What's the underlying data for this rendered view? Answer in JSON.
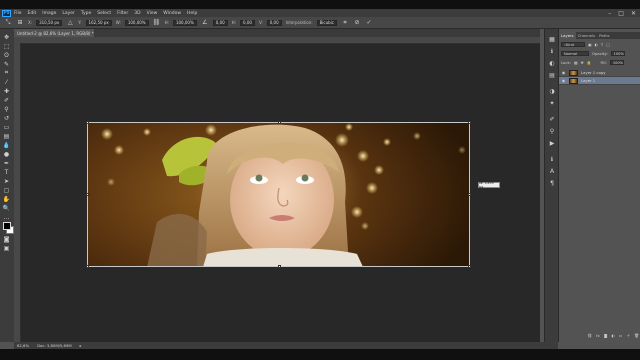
{
  "app": {
    "logo": "Ps"
  },
  "menu": [
    "File",
    "Edit",
    "Image",
    "Layer",
    "Type",
    "Select",
    "Filter",
    "3D",
    "View",
    "Window",
    "Help"
  ],
  "window_controls": [
    "–",
    "□",
    "✕"
  ],
  "options": {
    "x_value": "310,50 px",
    "y_value": "162,50 px",
    "w_value": "100,00%",
    "h_value": "100,00%",
    "angle_value": "0,00",
    "h_skew_value": "0,00",
    "v_skew_value": "0,00",
    "interpolation_label": "Interpolation:",
    "interpolation_value": "Bicubic"
  },
  "document": {
    "tab_title": "Untitled-2 @ 82,6% (Layer 1, RGB/8) *"
  },
  "canvas": {
    "tooltip": "W: 1395 px"
  },
  "layers_panel": {
    "tabs": [
      "Layers",
      "Channels",
      "Paths"
    ],
    "kind_label": "Kind",
    "blend_mode": "Normal",
    "opacity_label": "Opacity:",
    "opacity_value": "100%",
    "lock_label": "Lock:",
    "fill_label": "Fill:",
    "fill_value": "100%",
    "layers": [
      {
        "name": "Layer 1 copy",
        "selected": false
      },
      {
        "name": "Layer 1",
        "selected": true
      }
    ]
  },
  "status": {
    "zoom": "82,6%",
    "doc": "Doc: 3,80M/5,69M"
  },
  "colors": {
    "accent": "#31a8ff",
    "selection": "#6b7a8f",
    "canvas_bg": "#282828",
    "ui_bg": "#535353"
  }
}
